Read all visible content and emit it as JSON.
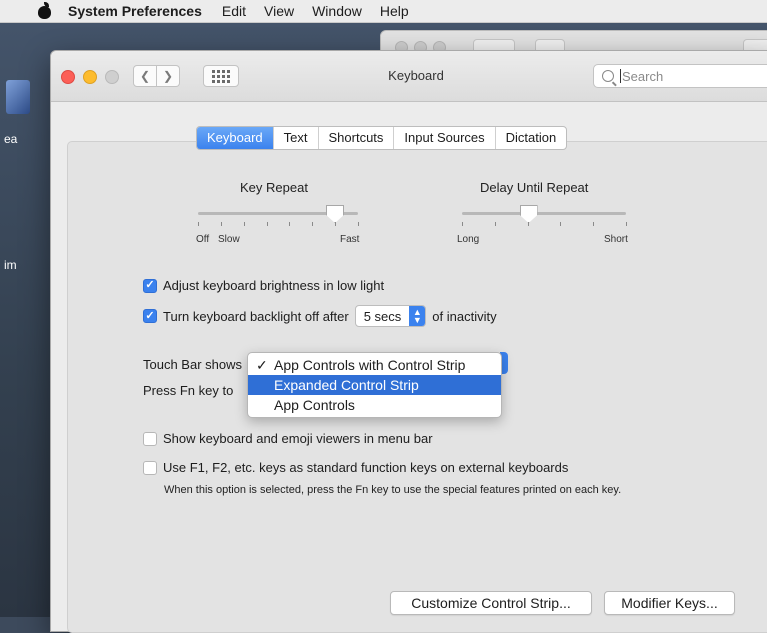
{
  "menubar": {
    "app_name": "System Preferences",
    "items": [
      "Edit",
      "View",
      "Window",
      "Help"
    ]
  },
  "desktop": {
    "label_1": "ea",
    "label_2": "im"
  },
  "window": {
    "title": "Keyboard",
    "search_placeholder": "Search",
    "search_value_prefix": "",
    "search_value_rest": "Search"
  },
  "tabs": [
    {
      "label": "Keyboard",
      "active": true
    },
    {
      "label": "Text",
      "active": false
    },
    {
      "label": "Shortcuts",
      "active": false
    },
    {
      "label": "Input Sources",
      "active": false
    },
    {
      "label": "Dictation",
      "active": false
    }
  ],
  "key_repeat": {
    "title": "Key Repeat",
    "label_left_1": "Off",
    "label_left_2": "Slow",
    "label_right": "Fast",
    "level_fraction": 0.85
  },
  "delay_until_repeat": {
    "title": "Delay Until Repeat",
    "label_left": "Long",
    "label_right": "Short",
    "level_fraction": 0.4
  },
  "options": {
    "brightness_label": "Adjust keyboard brightness in low light",
    "backlight_label_before": "Turn keyboard backlight off after",
    "backlight_value": "5 secs",
    "backlight_label_after": "of inactivity",
    "touchbar_label": "Touch Bar shows",
    "fn_label": "Press Fn key to",
    "emoji_label": "Show keyboard and emoji viewers in menu bar",
    "fkeys_label": "Use F1, F2, etc. keys as standard function keys on external keyboards",
    "fkeys_note": "When this option is selected, press the Fn key to use the special features printed on each key."
  },
  "dropdown": {
    "items": [
      {
        "label": "App Controls with Control Strip",
        "checked": true
      },
      {
        "label": "Expanded Control Strip",
        "highlighted": true
      },
      {
        "label": "App Controls"
      }
    ]
  },
  "buttons": {
    "customize": "Customize Control Strip...",
    "modifier": "Modifier Keys..."
  },
  "colors": {
    "accent": "#3b82ee",
    "highlight": "#2f6fd6",
    "close": "#fc5f57",
    "minimize": "#fdbc2e"
  }
}
